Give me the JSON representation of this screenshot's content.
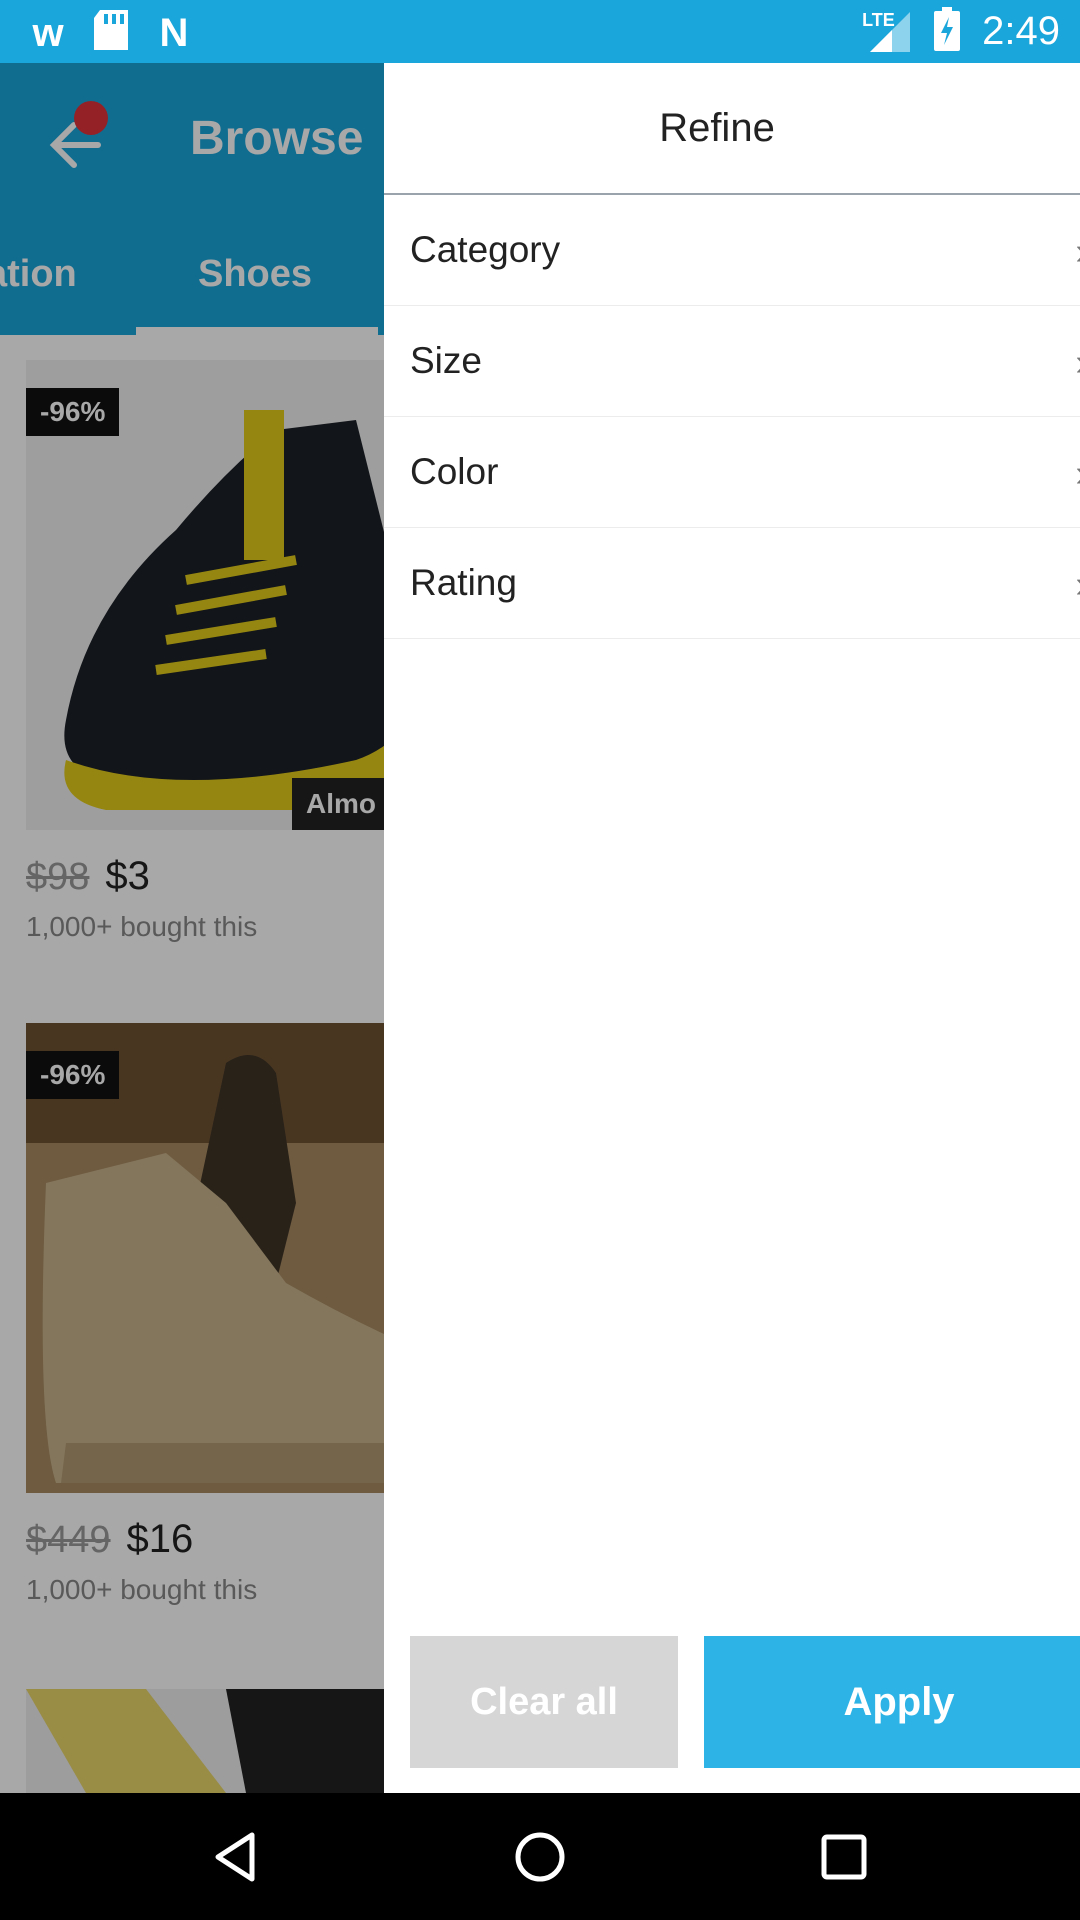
{
  "status_bar": {
    "time": "2:49",
    "network": "LTE",
    "left_icons": [
      "wish-logo-icon",
      "sd-card-icon",
      "n-logo-icon"
    ]
  },
  "browse": {
    "title": "Browse",
    "tabs": [
      {
        "label": "ation"
      },
      {
        "label": "Shoes"
      }
    ]
  },
  "products": [
    {
      "discount": "-96%",
      "old_price": "$98",
      "price": "$3",
      "bought": "1,000+ bought this",
      "overlay": "Almo"
    },
    {
      "discount": "-96%",
      "old_price": "$449",
      "price": "$16",
      "bought": "1,000+ bought this",
      "overlay": ""
    }
  ],
  "drawer": {
    "title": "Refine",
    "filters": [
      {
        "label": "Category"
      },
      {
        "label": "Size"
      },
      {
        "label": "Color"
      },
      {
        "label": "Rating"
      }
    ],
    "clear_label": "Clear all",
    "apply_label": "Apply"
  },
  "colors": {
    "accent": "#1ba6db",
    "apply_button": "#2db3e6",
    "clear_button": "#d6d6d6"
  }
}
